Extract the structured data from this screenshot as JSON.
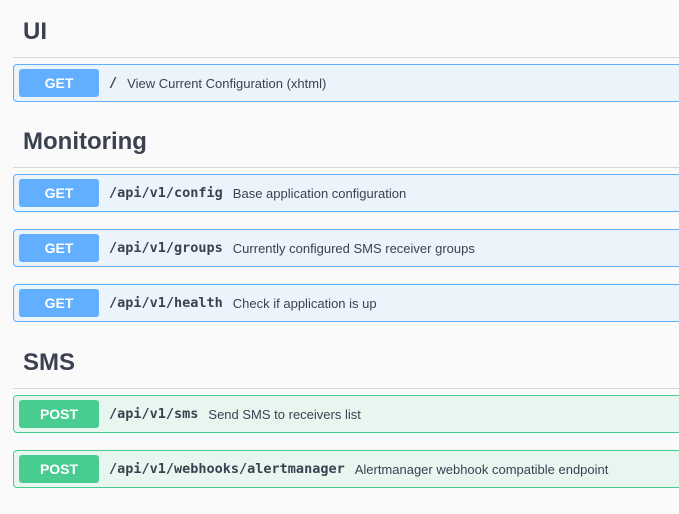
{
  "sections": [
    {
      "title": "UI",
      "operations": [
        {
          "method": "GET",
          "path": "/",
          "summary": "View Current Configuration (xhtml)"
        }
      ]
    },
    {
      "title": "Monitoring",
      "operations": [
        {
          "method": "GET",
          "path": "/api/v1/config",
          "summary": "Base application configuration"
        },
        {
          "method": "GET",
          "path": "/api/v1/groups",
          "summary": "Currently configured SMS receiver groups"
        },
        {
          "method": "GET",
          "path": "/api/v1/health",
          "summary": "Check if application is up"
        }
      ]
    },
    {
      "title": "SMS",
      "operations": [
        {
          "method": "POST",
          "path": "/api/v1/sms",
          "summary": "Send SMS to receivers list"
        },
        {
          "method": "POST",
          "path": "/api/v1/webhooks/alertmanager",
          "summary": "Alertmanager webhook compatible endpoint"
        }
      ]
    }
  ],
  "colors": {
    "get": "#61affe",
    "get_bg": "#ebf3fb",
    "post": "#49cc90",
    "post_bg": "#e8f6f0",
    "text": "#3b4151"
  }
}
